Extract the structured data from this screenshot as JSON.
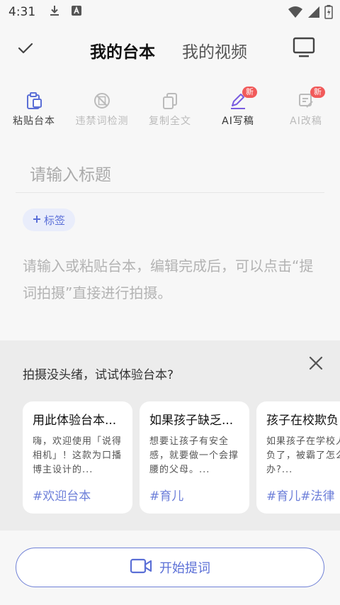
{
  "status_bar": {
    "time": "4:31",
    "icons": [
      "download-icon",
      "a-app-icon",
      "wifi-icon",
      "signal-icon",
      "battery-icon"
    ]
  },
  "header": {
    "tabs": [
      {
        "label": "我的台本",
        "active": true
      },
      {
        "label": "我的视频",
        "active": false
      }
    ],
    "left_icon": "check-icon",
    "right_icon": "monitor-icon"
  },
  "toolbar": {
    "items": [
      {
        "label": "粘贴台本",
        "icon": "paste-icon"
      },
      {
        "label": "违禁词检测",
        "icon": "forbidden-word-icon"
      },
      {
        "label": "复制全文",
        "icon": "copy-icon"
      },
      {
        "label": "AI写稿",
        "icon": "ai-pen-icon",
        "badge": "新"
      },
      {
        "label": "AI改稿",
        "icon": "ai-edit-icon",
        "badge": "新"
      }
    ]
  },
  "editor": {
    "title_placeholder": "请输入标题",
    "tag_label": "标签",
    "body_placeholder": "请输入或粘贴台本，编辑完成后，可以点击“提词拍摄”直接进行拍摄。"
  },
  "suggestions": {
    "title": "拍摄没头绪，试试体验台本?",
    "cards": [
      {
        "title": "用此体验台本...",
        "body": "嗨，欢迎使用「说得相机」！这款为口播博主设计的...",
        "tags": "#欢迎台本"
      },
      {
        "title": "如果孩子缺乏...",
        "body": "想要让孩子有安全感，就要做一个会撑腰的父母。...",
        "tags": "#育儿"
      },
      {
        "title": "孩子在校欺负",
        "body": "如果孩子在学校人欺负了，被霸了怎么办?...",
        "tags": "#育儿#法律"
      }
    ]
  },
  "bottom": {
    "start_label": "开始提词"
  },
  "colors": {
    "accent": "#5b6fd6",
    "badge": "#f15a5a",
    "tag_bg": "#e9edfb",
    "ai_icon": "#7a5ce0"
  }
}
